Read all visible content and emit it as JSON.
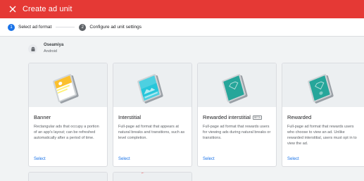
{
  "header": {
    "title": "Create ad unit",
    "close_icon": "close-icon"
  },
  "stepper": {
    "steps": [
      {
        "number": "1",
        "label": "Select ad format",
        "active": true
      },
      {
        "number": "2",
        "label": "Configure ad unit settings",
        "active": false
      }
    ]
  },
  "app": {
    "name": "Oseamiya",
    "platform": "Android",
    "icon": "android-icon"
  },
  "formats": [
    {
      "name": "Banner",
      "beta": "",
      "description": "Rectangular ads that occupy a portion of an app's layout; can be refreshed automatically after a period of time.",
      "select_label": "Select",
      "icon": "banner-illustration"
    },
    {
      "name": "Interstitial",
      "beta": "",
      "description": "Full-page ad format that appears at natural breaks and transitions, such as level completion.",
      "select_label": "Select",
      "icon": "interstitial-illustration"
    },
    {
      "name": "Rewarded interstitial",
      "beta": "BETA",
      "description": "Full-page ad format that rewards users for viewing ads during natural breaks or transitions.",
      "select_label": "Select",
      "icon": "rewarded-interstitial-illustration"
    },
    {
      "name": "Rewarded",
      "beta": "",
      "description": "Full-page ad format that rewards users who choose to view an ad. Unlike rewarded interstitial, users must opt in to view the ad.",
      "select_label": "Select",
      "icon": "rewarded-illustration"
    }
  ],
  "colors": {
    "header_bg": "#e53935",
    "accent": "#1a73e8",
    "teal": "#26a69a",
    "banner_yellow": "#fbc02d"
  }
}
